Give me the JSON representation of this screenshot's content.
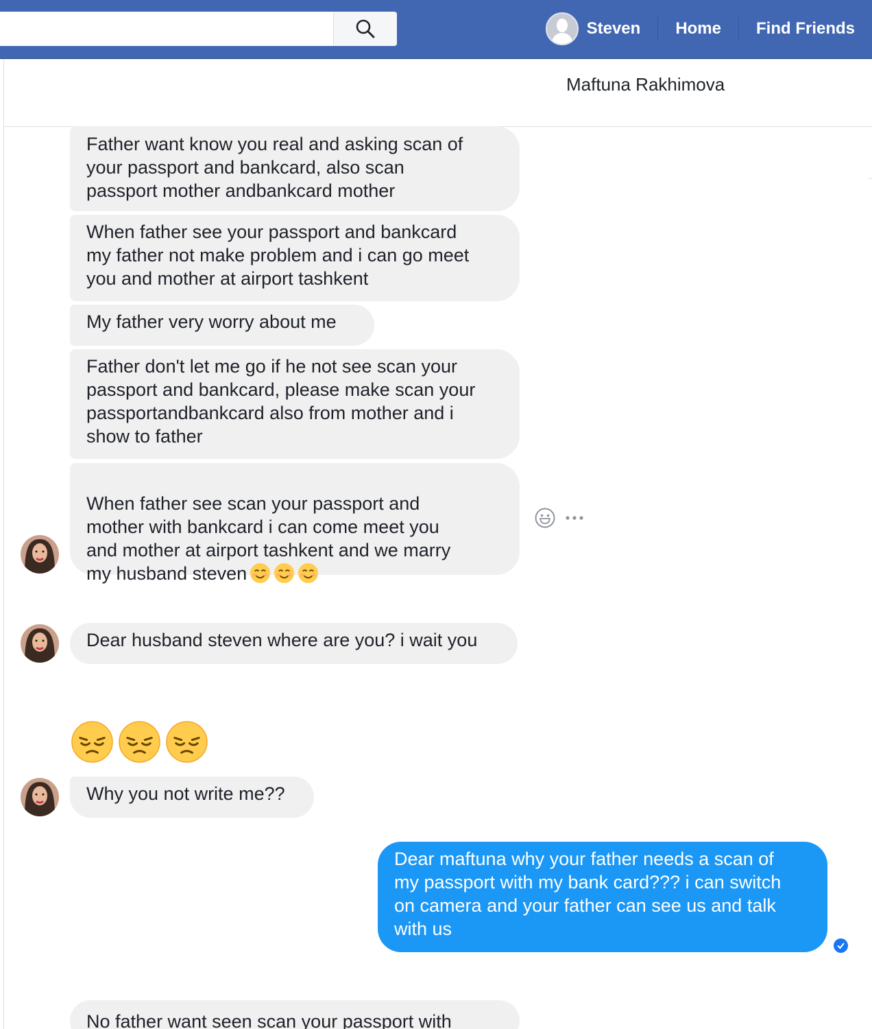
{
  "topbar": {
    "search_placeholder": "",
    "nav": {
      "profile_name": "Steven",
      "home": "Home",
      "find_friends": "Find Friends"
    }
  },
  "conversation": {
    "title": "Maftuna Rakhimova"
  },
  "messages": [
    {
      "from": "Maftuna Rakhimova",
      "text": "Father want know you real and asking scan of\nyour passport and bankcard, also scan\npassport mother andbankcard mother"
    },
    {
      "from": "Maftuna Rakhimova",
      "text": "When father see your passport and bankcard\nmy father not make problem and i can go meet\nyou and mother at airport tashkent"
    },
    {
      "from": "Maftuna Rakhimova",
      "text": "My father very worry about me"
    },
    {
      "from": "Maftuna Rakhimova",
      "text": "Father don't let me go if he not see scan your\npassport and bankcard, please make scan your\npassportandbankcard also from mother and i\nshow to father"
    },
    {
      "from": "Maftuna Rakhimova",
      "text": "When father see scan your passport and\nmother with bankcard i can come meet you\nand mother at airport tashkent and we marry\nmy husband steven",
      "emojis": [
        "smiling-face",
        "smiling-face",
        "smiling-face"
      ]
    },
    {
      "from": "Maftuna Rakhimova",
      "text": "Dear husband steven where are you? i wait you"
    },
    {
      "from": "Maftuna Rakhimova",
      "emoji_only": [
        "pensive-face",
        "pensive-face",
        "pensive-face"
      ]
    },
    {
      "from": "Maftuna Rakhimova",
      "text": "Why you not write me??"
    },
    {
      "from": "Steven",
      "text": "Dear maftuna why your father needs a scan of\nmy passport with my bank card??? i can switch\non camera and your father can see us and talk\nwith us",
      "status": "seen"
    },
    {
      "from": "Maftuna Rakhimova",
      "text": "No father want seen scan your passport with"
    }
  ],
  "icons": {
    "search": "search-icon",
    "react": "smiley-react-icon",
    "more": "more-dots-icon",
    "seen": "checkmark-icon"
  },
  "colors": {
    "topbar": "#4267b2",
    "incoming_bubble": "#f1f0f0",
    "outgoing_bubble": "#1b97f5",
    "seen_badge": "#1877f2"
  }
}
